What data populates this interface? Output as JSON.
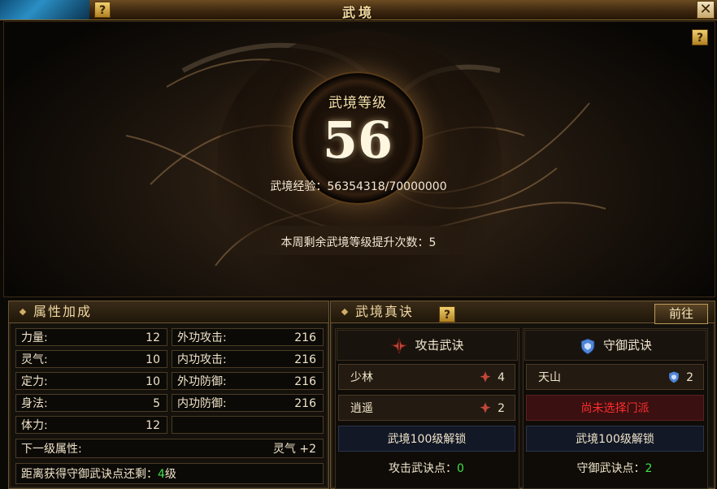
{
  "window": {
    "title": "武境"
  },
  "help_icon_label": "?",
  "close_icon_label": "✕",
  "hero": {
    "level_label": "武境等级",
    "level_value": "56",
    "exp_label": "武境经验：",
    "exp_value": "56354318/70000000",
    "weekly_label": "本周剩余武境等级提升次数：",
    "weekly_value": "5"
  },
  "attributes": {
    "title": "属性加成",
    "left": [
      {
        "label": "力量:",
        "value": "12"
      },
      {
        "label": "灵气:",
        "value": "10"
      },
      {
        "label": "定力:",
        "value": "10"
      },
      {
        "label": "身法:",
        "value": "5"
      },
      {
        "label": "体力:",
        "value": "12"
      }
    ],
    "right": [
      {
        "label": "外功攻击:",
        "value": "216"
      },
      {
        "label": "内功攻击:",
        "value": "216"
      },
      {
        "label": "外功防御:",
        "value": "216"
      },
      {
        "label": "内功防御:",
        "value": "216"
      },
      {
        "label": "",
        "value": ""
      }
    ],
    "next_level_label": "下一级属性:",
    "next_level_value": "灵气 +2",
    "guard_points_prefix": "距离获得守御武诀点还剩：",
    "guard_points_value": "4",
    "guard_points_suffix": "级"
  },
  "skills": {
    "title": "武境真诀",
    "goto_label": "前往",
    "attack": {
      "title": "攻击武诀",
      "rows": [
        {
          "name": "少林",
          "count": "4"
        },
        {
          "name": "逍遥",
          "count": "2"
        }
      ],
      "unlock_label": "武境100级解锁",
      "points_label": "攻击武诀点：",
      "points_value": "0"
    },
    "defense": {
      "title": "守御武诀",
      "rows": [
        {
          "name": "天山",
          "count": "2"
        }
      ],
      "not_selected_label": "尚未选择门派",
      "unlock_label": "武境100级解锁",
      "points_label": "守御武诀点：",
      "points_value": "2"
    }
  },
  "colors": {
    "accent_gold": "#f1d8a3",
    "attack_icon": "#c0473a",
    "defense_icon": "#4f86d8",
    "highlight_green": "#3fe04a",
    "warning_red": "#ff2d2d"
  }
}
